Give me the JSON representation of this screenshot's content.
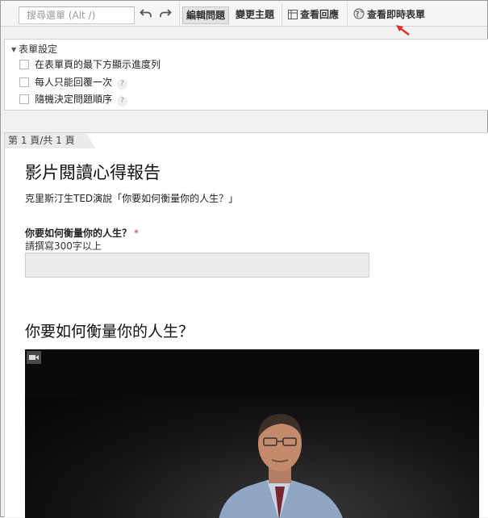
{
  "toolbar": {
    "search_placeholder": "搜尋選單 (Alt /)",
    "undo_icon": "undo-icon",
    "redo_icon": "redo-icon",
    "edit_questions": "編輯問題",
    "change_theme": "變更主題",
    "view_responses": "查看回應",
    "view_live_form": "查看即時表單"
  },
  "settings": {
    "heading": "表單設定",
    "options": [
      {
        "label": "在表單頁的最下方顯示進度列",
        "checked": false,
        "help": false
      },
      {
        "label": "每人只能回覆一次",
        "checked": false,
        "help": true
      },
      {
        "label": "隨機決定問題順序",
        "checked": false,
        "help": true
      }
    ],
    "help_glyph": "?"
  },
  "page": {
    "tab_label": "第 1 頁/共 1 頁",
    "form_title": "影片閱讀心得報告",
    "form_description": "克里斯汀生TED演說「你要如何衡量你的人生？」",
    "question": {
      "title": "你要如何衡量你的人生？",
      "required_mark": "*",
      "help_text": "請撰寫300字以上"
    },
    "video_heading": "你要如何衡量你的人生？"
  },
  "colors": {
    "accent_arrow": "#d9302c",
    "required": "#cc4433",
    "video_bg": "#0a0a0a"
  }
}
